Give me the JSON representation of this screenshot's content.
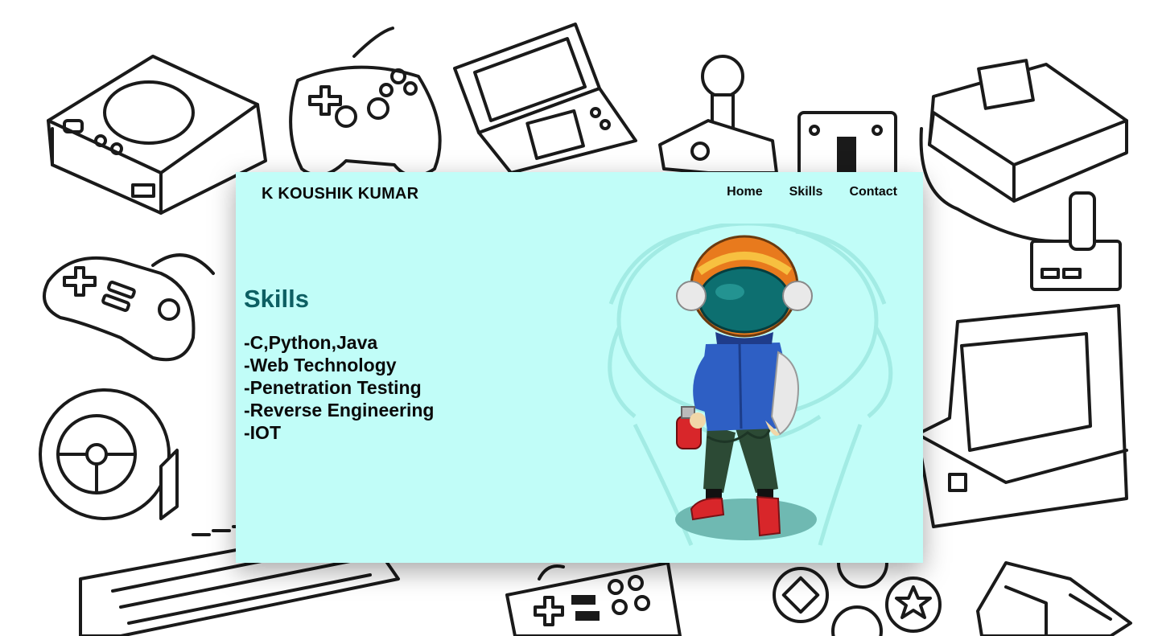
{
  "header": {
    "brand": "K KOUSHIK KUMAR",
    "nav": [
      "Home",
      "Skills",
      "Contact"
    ]
  },
  "main": {
    "section_title": "Skills",
    "skills": [
      "-C,Python,Java",
      "-Web Technology",
      "-Penetration Testing",
      "-Reverse Engineering",
      "-IOT"
    ]
  },
  "hero_image": {
    "icon": "astronaut-character-illustration"
  },
  "background": {
    "icon": "game-controllers-doodle-pattern"
  },
  "colors": {
    "card_background": "#c1fdf8",
    "section_title": "#0d5f63",
    "text": "#0a0a0a"
  }
}
